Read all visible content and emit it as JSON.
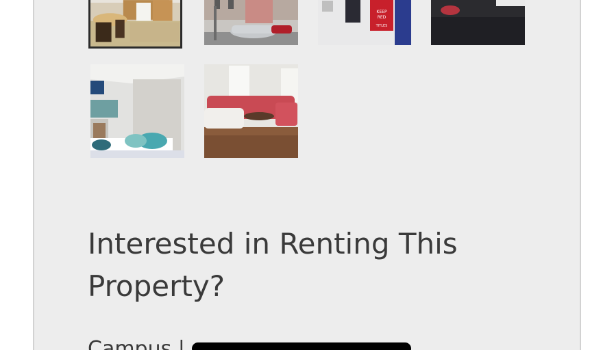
{
  "gallery": {
    "photos": [
      {
        "name": "kitchen-photo",
        "selected": true
      },
      {
        "name": "street-photo",
        "selected": false
      },
      {
        "name": "bedroom-poster-photo",
        "selected": false
      },
      {
        "name": "bedroom-bed-photo",
        "selected": false
      },
      {
        "name": "bedroom-loft-photo",
        "selected": false
      },
      {
        "name": "living-room-photo",
        "selected": false
      }
    ],
    "poster_text": "KEEP RED AND WIN TITLES"
  },
  "inquiry": {
    "heading_line1": "Interested in Renting This",
    "heading_line2": "Property?",
    "campus_label": "Campus |"
  }
}
